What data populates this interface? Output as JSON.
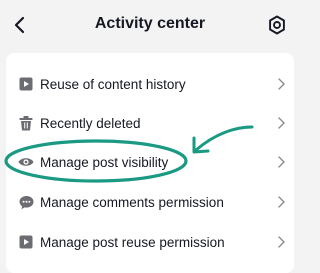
{
  "header": {
    "title": "Activity center",
    "back_icon": "chevron-left-icon",
    "settings_icon": "gear-icon"
  },
  "menu": {
    "items": [
      {
        "label": "Reuse of content history",
        "icon": "play-box-icon"
      },
      {
        "label": "Recently deleted",
        "icon": "trash-icon"
      },
      {
        "label": "Manage post visibility",
        "icon": "eye-icon"
      },
      {
        "label": "Manage comments permission",
        "icon": "comment-icon"
      },
      {
        "label": "Manage post reuse permission",
        "icon": "play-box-icon"
      }
    ]
  },
  "annotation": {
    "highlight_color": "#1a9a83",
    "highlighted_item": "Manage post visibility"
  }
}
